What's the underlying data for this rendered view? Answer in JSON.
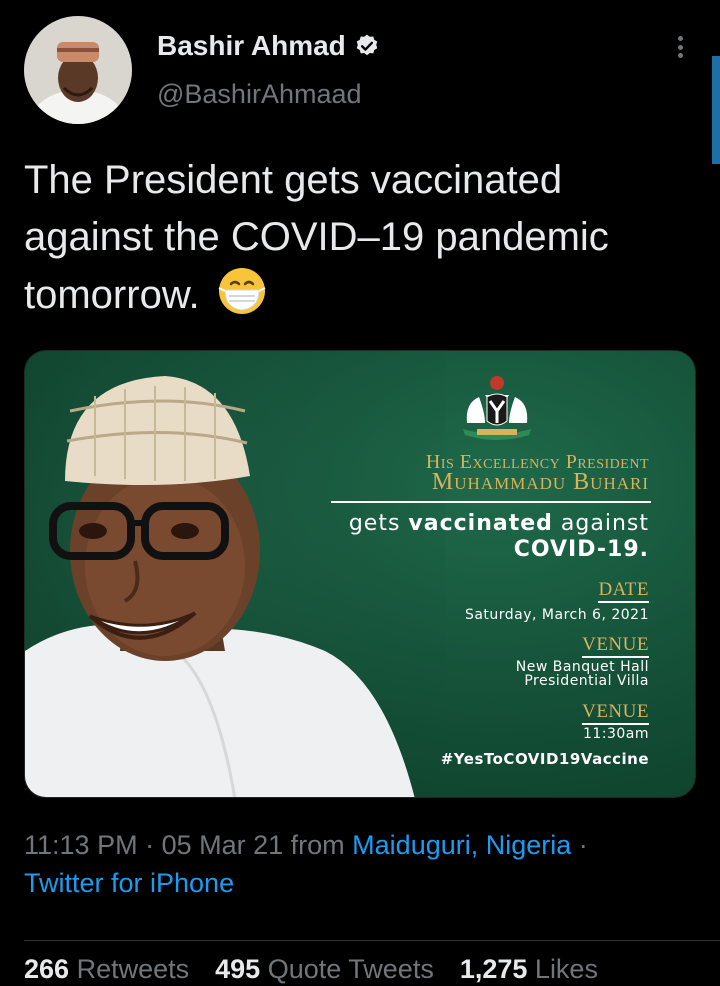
{
  "author": {
    "name": "Bashir Ahmad",
    "handle": "@BashirAhmaad",
    "verified": true
  },
  "tweet": {
    "text": "The President gets vaccinated against the COVID–19 pandemic tomorrow.",
    "emoji": "face-with-medical-mask"
  },
  "card": {
    "title_line1": "His Excellency President",
    "title_line2": "Muhammadu Buhari",
    "gets_prefix": "gets ",
    "gets_bold": "vaccinated",
    "gets_suffix": " against",
    "covid": "COVID-19.",
    "date_label": "DATE",
    "date_value": "Saturday, March 6, 2021",
    "venue_label": "VENUE",
    "venue_line1": "New Banquet Hall",
    "venue_line2": "Presidential Villa",
    "venue2_label": "VENUE",
    "time_value": "11:30am",
    "hashtag": "#YesToCOVID19Vaccine"
  },
  "meta": {
    "time": "11:13 PM",
    "separator": " · ",
    "date": "05 Mar 21",
    "from_text": " from ",
    "location": "Maiduguri, Nigeria",
    "separator2": " ·",
    "source": "Twitter for iPhone"
  },
  "stats": {
    "retweets_count": "266",
    "retweets_label": "Retweets",
    "quotes_count": "495",
    "quotes_label": "Quote Tweets",
    "likes_count": "1,275",
    "likes_label": "Likes"
  },
  "colors": {
    "background": "#000000",
    "link": "#1d9bf0",
    "muted": "#71767b",
    "card_green": "#134d35",
    "gold": "#d8b25d"
  }
}
